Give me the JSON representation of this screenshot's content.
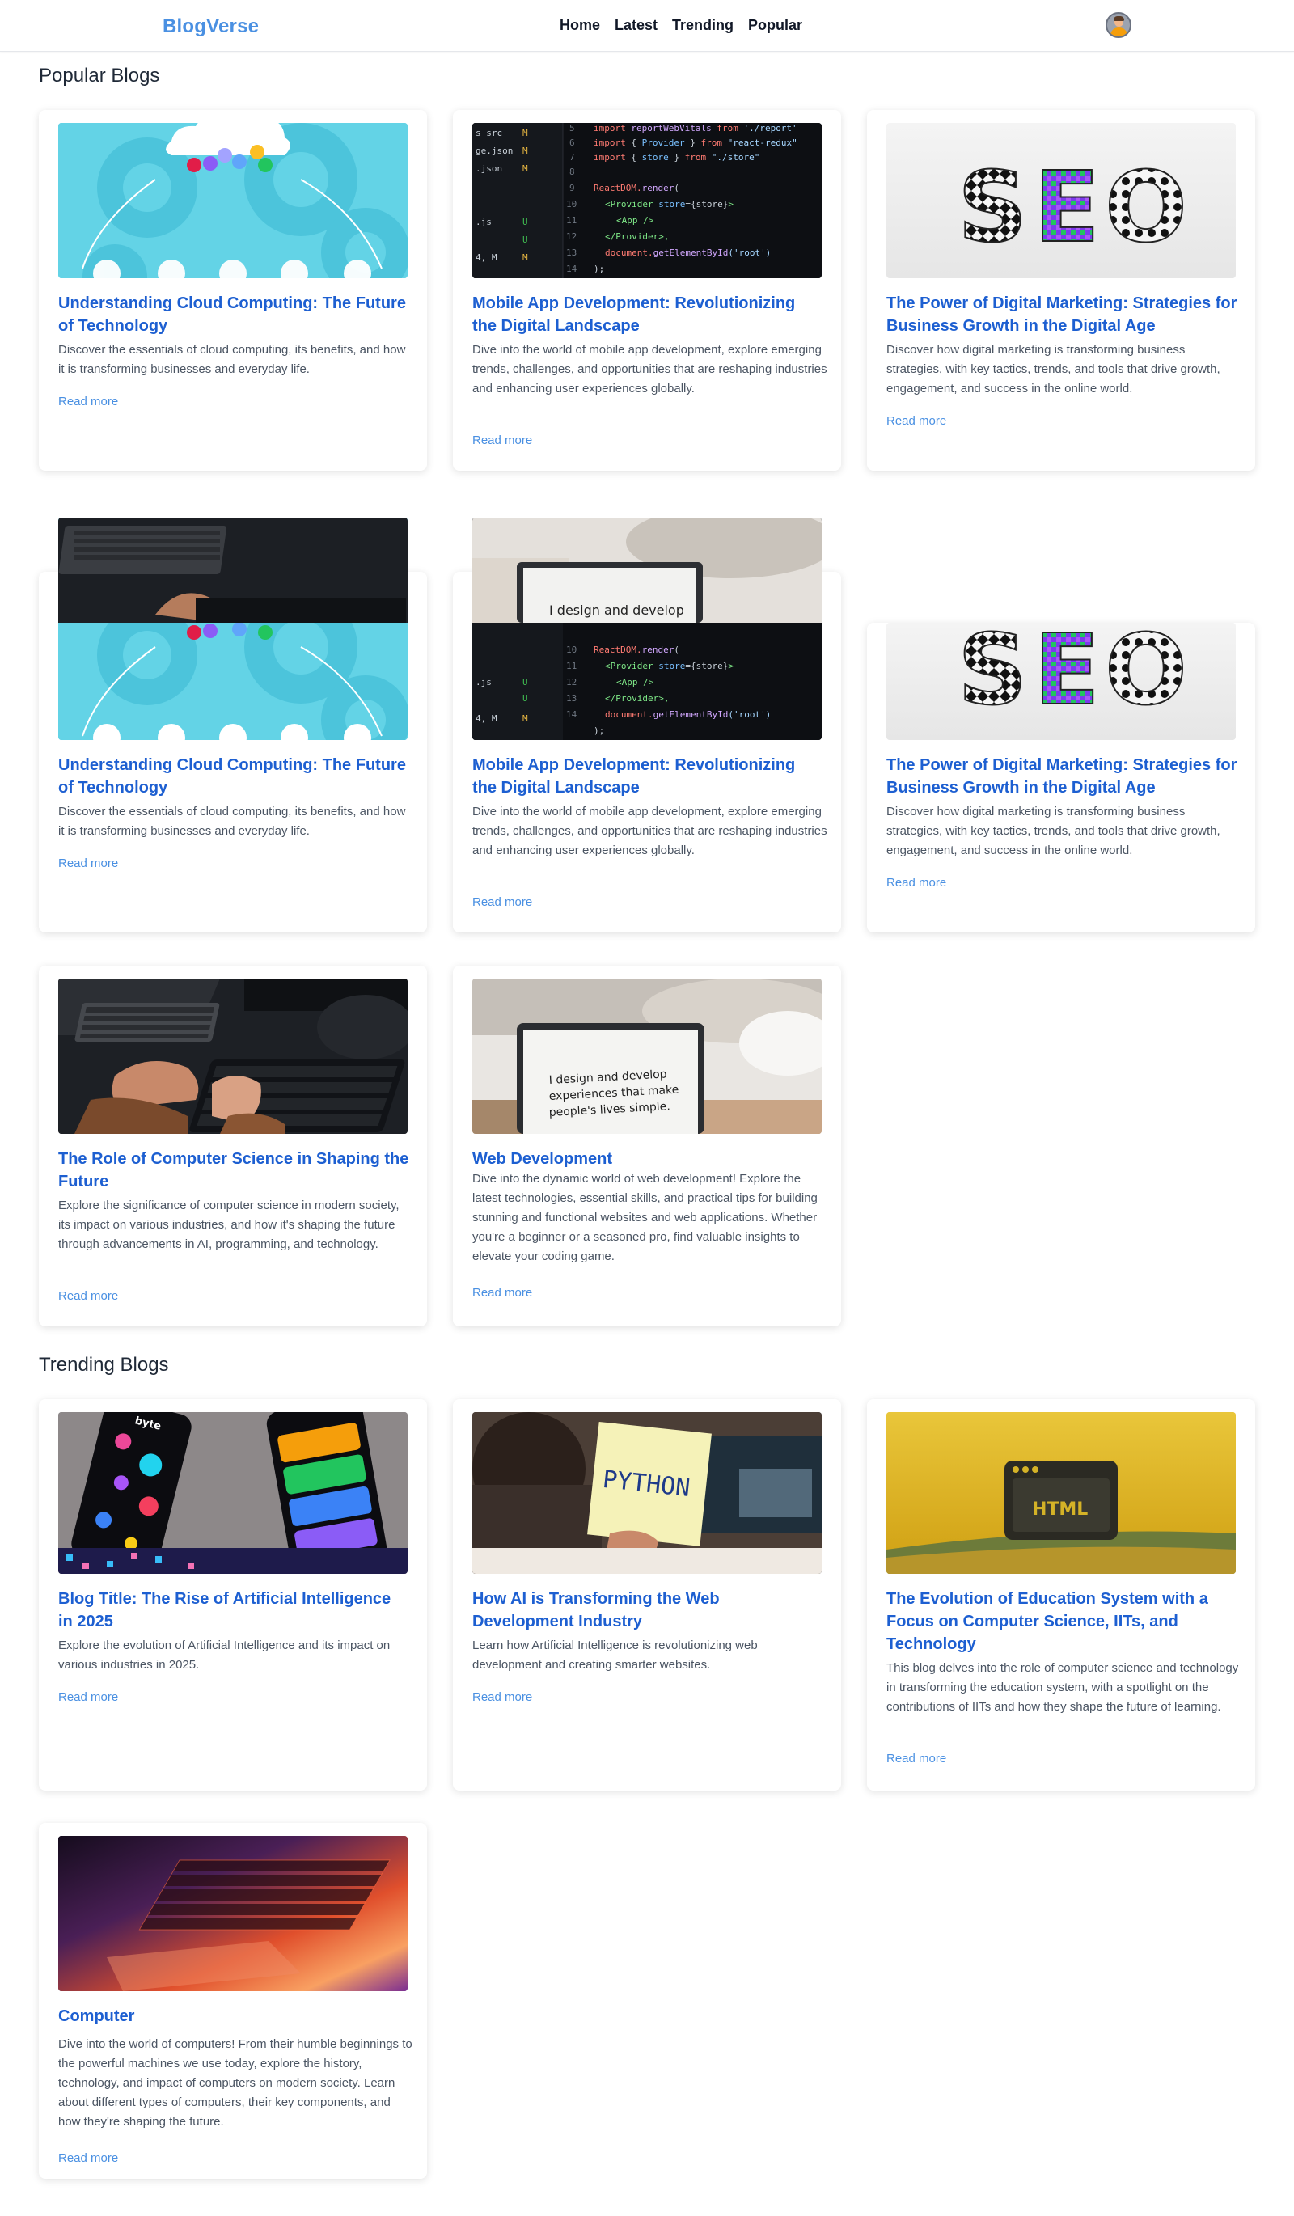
{
  "nav": {
    "brand": "BlogVerse",
    "links": [
      "Home",
      "Latest",
      "Trending",
      "Popular"
    ]
  },
  "popular": {
    "heading": "Popular Blogs",
    "cards": [
      {
        "title": "Understanding Cloud Computing: The Future of Technology",
        "desc": "Discover the essentials of cloud computing, its benefits, and how it is transforming businesses and everyday life.",
        "link": "Read more",
        "image": "cloud-gears-illustration"
      },
      {
        "title": "Mobile App Development: Revolutionizing the Digital Landscape",
        "desc": "Dive into the world of mobile app development, explore emerging trends, challenges, and opportunities that are reshaping industries and enhancing user experiences globally.",
        "link": "Read more",
        "image": "react-code-screen"
      },
      {
        "title": "The Power of Digital Marketing: Strategies for Business Growth in the Digital Age",
        "desc": "Discover how digital marketing is transforming business strategies, with key tactics, trends, and tools that drive growth, engagement, and success in the online world.",
        "link": "Read more",
        "image": "seo-letters"
      },
      {
        "title": "Understanding Cloud Computing: The Future of Technology",
        "desc": "Discover the essentials of cloud computing, its benefits, and how it is transforming businesses and everyday life.",
        "link": "Read more",
        "image": "keyboard-over-cloud"
      },
      {
        "title": "Mobile App Development: Revolutionizing the Digital Landscape",
        "desc": "Dive into the world of mobile app development, explore emerging trends, challenges, and opportunities that are reshaping industries and enhancing user experiences globally.",
        "link": "Read more",
        "image": "laptop-over-code"
      },
      {
        "title": "The Power of Digital Marketing: Strategies for Business Growth in the Digital Age",
        "desc": "Discover how digital marketing is transforming business strategies, with key tactics, trends, and tools that drive growth, engagement, and success in the online world.",
        "link": "Read more",
        "image": "seo-letters"
      },
      {
        "title": "The Role of Computer Science in Shaping the Future",
        "desc": "Explore the significance of computer science in modern society, its impact on various industries, and how it's shaping the future through advancements in AI, programming, and technology.",
        "link": "Read more",
        "image": "keyboard-typing"
      },
      {
        "title": "Web Development",
        "desc": "Dive into the dynamic world of web development! Explore the latest technologies, essential skills, and practical tips for building stunning and functional websites and web applications. Whether you're a beginner or a seasoned pro, find valuable insights to elevate your coding game.",
        "link": "Read more",
        "image": "laptop-design-quote"
      }
    ],
    "laptop_quote": [
      "I design and develop",
      "experiences that make",
      "people's lives simple."
    ],
    "seo_text": "SEO"
  },
  "trending": {
    "heading": "Trending Blogs",
    "cards": [
      {
        "title": "Blog Title: The Rise of Artificial Intelligence in 2025",
        "desc": "Explore the evolution of Artificial Intelligence and its impact on various industries in 2025.",
        "link": "Read more",
        "image": "phones-app-screens"
      },
      {
        "title": "How AI is Transforming the Web Development Industry",
        "desc": "Learn how Artificial Intelligence is revolutionizing web development and creating smarter websites.",
        "link": "Read more",
        "image": "python-sticky-note"
      },
      {
        "title": "The Evolution of Education System with a Focus on Computer Science, IITs, and Technology",
        "desc": "This blog delves into the role of computer science and technology in transforming the education system, with a spotlight on the contributions of IITs and how they shape the future of learning.",
        "link": "Read more",
        "image": "html-window-yellow"
      },
      {
        "title": "Computer",
        "desc": "Dive into the world of computers! From their humble beginnings to the powerful machines we use today, explore the history, technology, and impact of computers on modern society. Learn about different types of computers, their key components, and how they're shaping the future.",
        "link": "Read more",
        "image": "macbook-keyboard-gradient"
      }
    ],
    "python_text": "PYTHON",
    "html_text": "HTML",
    "byte_text": "byte"
  },
  "code_lines": {
    "numbers": [
      "5",
      "6",
      "7",
      "8",
      "9",
      "10",
      "11",
      "12",
      "13",
      "14"
    ],
    "left_labels": [
      ".s src",
      "ge.json",
      ".json",
      "",
      ".js",
      "s",
      "",
      ".js",
      ".s",
      "4, M"
    ],
    "left_marks": [
      "M",
      "M",
      "M",
      "",
      "",
      "U",
      "M",
      "U",
      "U",
      "M"
    ]
  },
  "colors": {
    "brand": "#4a90e2",
    "card_title": "#1d5fd1",
    "link": "#4a90e2",
    "cloud_bg": "#63d3e6"
  }
}
